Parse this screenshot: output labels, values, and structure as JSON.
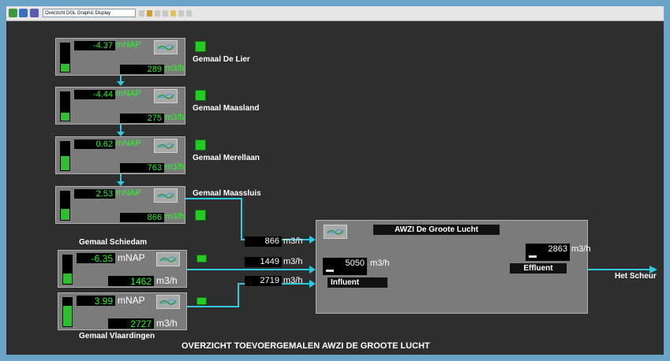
{
  "toolbar": {
    "title": "Overzicht DGL Graphic Display"
  },
  "stations_top": [
    {
      "name": "Gemaal De Lier",
      "level": "-4.37",
      "level_unit": "mNAP",
      "flow": "289",
      "flow_unit": "m3/h"
    },
    {
      "name": "Gemaal Maasland",
      "level": "-4.44",
      "level_unit": "mNAP",
      "flow": "275",
      "flow_unit": "m3/h"
    },
    {
      "name": "Gemaal Merellaan",
      "level": "0.62",
      "level_unit": "mNAP",
      "flow": "763",
      "flow_unit": "m3/h"
    },
    {
      "name": "Gemaal Maassluis",
      "level": "2.53",
      "level_unit": "mNAP",
      "flow": "866",
      "flow_unit": "m3/h"
    }
  ],
  "stations_bottom": [
    {
      "name": "Gemaal Schiedam",
      "level": "-6.35",
      "level_unit": "mNAP",
      "flow": "1462",
      "flow_unit": "m3/h"
    },
    {
      "name": "Gemaal Vlaardingen",
      "level": "3.99",
      "level_unit": "mNAP",
      "flow": "2727",
      "flow_unit": "m3/h"
    }
  ],
  "inflows": [
    {
      "value": "866",
      "unit": "m3/h"
    },
    {
      "value": "1449",
      "unit": "m3/h"
    },
    {
      "value": "2719",
      "unit": "m3/h"
    }
  ],
  "plant": {
    "title": "AWZI De Groote Lucht",
    "influent_value": "5050",
    "influent_unit": "m3/h",
    "influent_label": "Influent",
    "effluent_value": "2863",
    "effluent_unit": "m3/h",
    "effluent_label": "Effluent"
  },
  "destination": "Het Scheur",
  "footer": "OVERZICHT TOEVOERGEMALEN AWZI DE GROOTE LUCHT",
  "colors": {
    "value_green": "#2cf52c",
    "indicator": "#22cc22",
    "flow_line": "#2ec8e0",
    "panel": "#7b7b7b"
  },
  "icons": {
    "trend": "trend-chart-icon",
    "arrow": "flow-arrow-icon"
  }
}
